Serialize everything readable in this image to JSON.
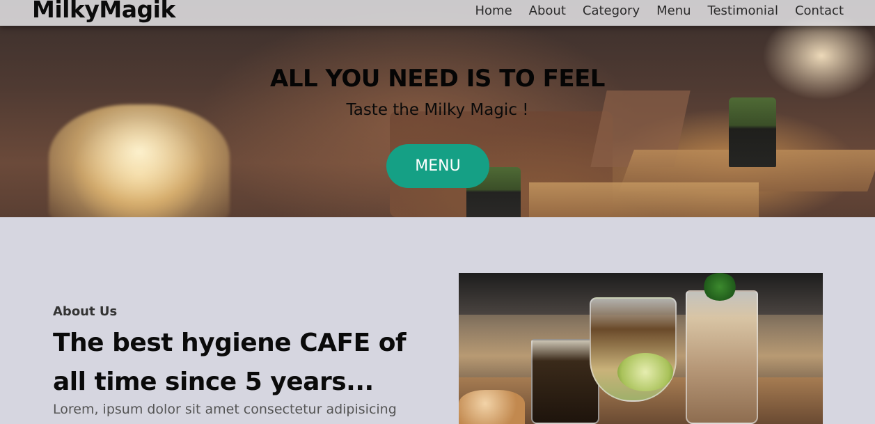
{
  "brand": "MilkyMagik",
  "nav": {
    "items": [
      "Home",
      "About",
      "Category",
      "Menu",
      "Testimonial",
      "Contact"
    ]
  },
  "hero": {
    "title": "ALL YOU NEED IS TO FEEL",
    "subtitle": "Taste the Milky Magic !",
    "cta_label": "MENU",
    "cta_color": "#15a085"
  },
  "about": {
    "kicker": "About Us",
    "title": "The best hygiene CAFE of all time since 5 years...",
    "text": "Lorem, ipsum dolor sit amet consectetur adipisicing"
  },
  "colors": {
    "page_bg": "#d6d6e0",
    "accent": "#15a085"
  }
}
